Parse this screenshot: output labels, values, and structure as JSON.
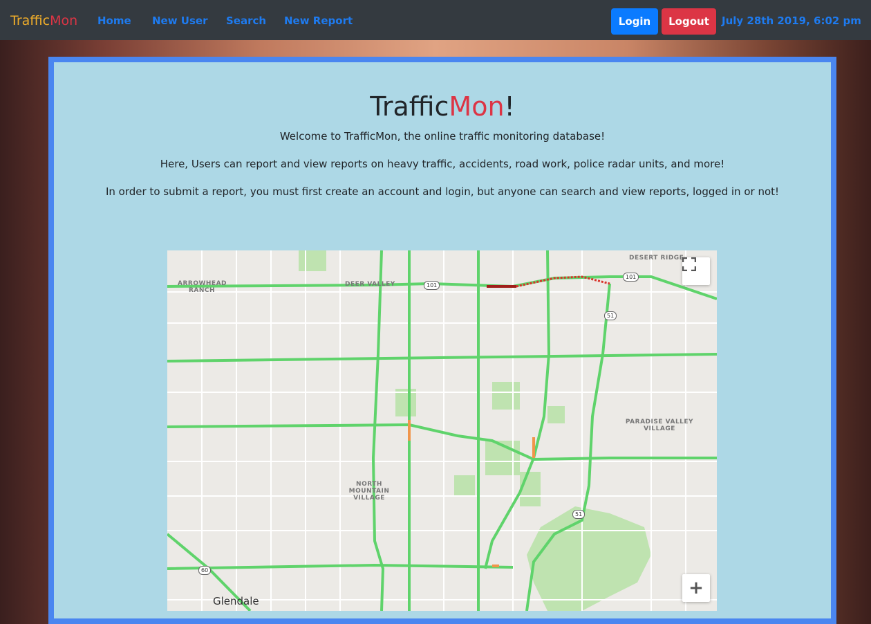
{
  "nav": {
    "brand_part1": "Traffic",
    "brand_part2": "Mon",
    "links": [
      "Home",
      "New User",
      "Search",
      "New Report"
    ],
    "login_label": "Login",
    "logout_label": "Logout",
    "datetime": "July 28th 2019, 6:02 pm"
  },
  "main": {
    "title_part1": "Traffic",
    "title_part2": "Mon",
    "title_part3": "!",
    "welcome": "Welcome to TrafficMon, the online traffic monitoring database!",
    "description": "Here, Users can report and view reports on heavy traffic, accidents, road work, police radar units, and more!",
    "instructions": "In order to submit a report, you must first create an account and login, but anyone can search and view reports, logged in or not!"
  },
  "map": {
    "places": {
      "desert_ridge": "DESERT RIDGE",
      "arrowhead_ranch": "ARROWHEAD RANCH",
      "deer_valley": "DEER VALLEY",
      "paradise_valley_village": "PARADISE VALLEY VILLAGE",
      "north_mountain_village": "NORTH MOUNTAIN VILLAGE",
      "glendale": "Glendale"
    },
    "shields": {
      "hwy101_a": "101",
      "hwy101_b": "101",
      "hwy51_a": "51",
      "hwy51_b": "51",
      "hwy60": "60"
    },
    "zoom_in_label": "+",
    "colors": {
      "road_flow": "#5fd36b",
      "road_slow": "#f0954a",
      "road_heavy": "#d8342b",
      "park": "#bfe3b0"
    },
    "icons": [
      "fullscreen-icon",
      "zoom-in-icon"
    ]
  },
  "colors": {
    "navbar_bg": "#343a40",
    "nav_link": "#1e7bf0",
    "login_bg": "#0b7bff",
    "logout_bg": "#dc3545",
    "panel_bg": "#add8e6",
    "panel_border": "#4a86f0"
  }
}
